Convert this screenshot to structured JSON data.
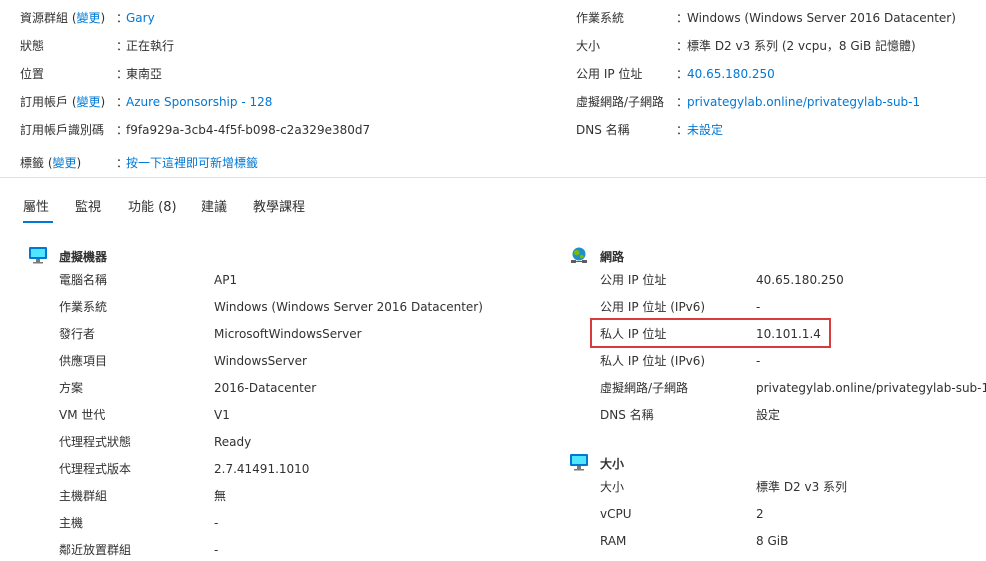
{
  "essentials": {
    "left": [
      {
        "label": "資源群組 (",
        "change": "變更",
        "label_end": ")",
        "value": "Gary",
        "value_link": true
      },
      {
        "label": "狀態",
        "value": "正在執行",
        "value_link": false
      },
      {
        "label": "位置",
        "value": "東南亞",
        "value_link": false
      },
      {
        "label": "訂用帳戶 (",
        "change": "變更",
        "label_end": ")",
        "value": "Azure Sponsorship - 128",
        "value_link": true
      },
      {
        "label": "訂用帳戶識別碼",
        "value": "f9fa929a-3cb4-4f5f-b098-c2a329e380d7",
        "value_link": false
      }
    ],
    "right": [
      {
        "label": "作業系統",
        "value": "Windows (Windows Server 2016 Datacenter)",
        "value_link": false
      },
      {
        "label": "大小",
        "value": "標準 D2 v3 系列 (2 vcpu，8 GiB 記憶體)",
        "value_link": false
      },
      {
        "label": "公用 IP 位址",
        "value": "40.65.180.250",
        "value_link": true
      },
      {
        "label": "虛擬網路/子網路",
        "value": "privategylab.online/privategylab-sub-1",
        "value_link": true
      },
      {
        "label": "DNS 名稱",
        "value": "未設定",
        "value_link": true
      }
    ],
    "tags": {
      "label": "標籤 (",
      "change": "變更",
      "label_end": ")",
      "value": "按一下這裡即可新增標籤"
    },
    "colon": "："
  },
  "tabs": [
    "屬性",
    "監視",
    "功能 (8)",
    "建議",
    "教學課程"
  ],
  "vm_section": {
    "title": "虛擬機器",
    "icon": "monitor-icon",
    "rows": [
      {
        "label": "電腦名稱",
        "value": "AP1"
      },
      {
        "label": "作業系統",
        "value": "Windows (Windows Server 2016 Datacenter)"
      },
      {
        "label": "發行者",
        "value": "MicrosoftWindowsServer"
      },
      {
        "label": "供應項目",
        "value": "WindowsServer"
      },
      {
        "label": "方案",
        "value": "2016-Datacenter"
      },
      {
        "label": "VM 世代",
        "value": "V1"
      },
      {
        "label": "代理程式狀態",
        "value": "Ready"
      },
      {
        "label": "代理程式版本",
        "value": "2.7.41491.1010"
      },
      {
        "label": "主機群組",
        "value": "無"
      },
      {
        "label": "主機",
        "value": "-"
      },
      {
        "label": "鄰近放置群組",
        "value": "-"
      }
    ]
  },
  "network_section": {
    "title": "網路",
    "icon": "network-globe-icon",
    "rows": [
      {
        "label": "公用 IP 位址",
        "value": "40.65.180.250"
      },
      {
        "label": "公用 IP 位址 (IPv6)",
        "value": "-"
      },
      {
        "label": "私人 IP 位址",
        "value": "10.101.1.4"
      },
      {
        "label": "私人 IP 位址 (IPv6)",
        "value": "-"
      },
      {
        "label": "虛擬網路/子網路",
        "value": "privategylab.online/privategylab-sub-1"
      },
      {
        "label": "DNS 名稱",
        "value": "設定"
      }
    ]
  },
  "size_section": {
    "title": "大小",
    "icon": "monitor-icon",
    "rows": [
      {
        "label": "大小",
        "value": "標準 D2 v3 系列"
      },
      {
        "label": "vCPU",
        "value": "2"
      },
      {
        "label": "RAM",
        "value": "8 GiB"
      }
    ]
  },
  "colors": {
    "link": "#0078d4",
    "text": "#323130",
    "highlight": "#d73b3b",
    "divider": "#e1dfdd"
  }
}
